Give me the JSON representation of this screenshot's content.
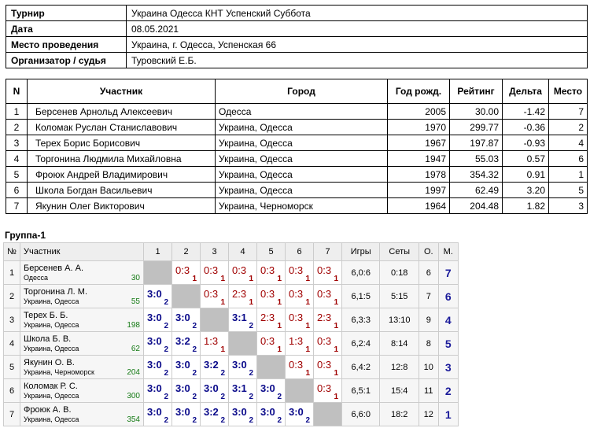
{
  "info": [
    {
      "k": "Турнир",
      "v": "Украина Одесса КНТ Успенский  Суббота"
    },
    {
      "k": "Дата",
      "v": "08.05.2021"
    },
    {
      "k": "Место проведения",
      "v": "Украина, г. Одесса, Успенская 66"
    },
    {
      "k": "Организатор / судья",
      "v": "Туровский Е.Б."
    }
  ],
  "participants": {
    "headers": [
      "N",
      "Участник",
      "Город",
      "Год рожд.",
      "Рейтинг",
      "Дельта",
      "Место"
    ],
    "rows": [
      [
        "1",
        "Берсенев Арнольд Алексеевич",
        "Одесса",
        "2005",
        "30.00",
        "-1.42",
        "7"
      ],
      [
        "2",
        "Коломак Руслан Станиславович",
        "Украина, Одесса",
        "1970",
        "299.77",
        "-0.36",
        "2"
      ],
      [
        "3",
        "Терех Борис Борисович",
        "Украина, Одесса",
        "1967",
        "197.87",
        "-0.93",
        "4"
      ],
      [
        "4",
        "Торгонина Людмила Михайловна",
        "Украина, Одесса",
        "1947",
        "55.03",
        "0.57",
        "6"
      ],
      [
        "5",
        "Фроюк Андрей Владимирович",
        "Украина, Одесса",
        "1978",
        "354.32",
        "0.91",
        "1"
      ],
      [
        "6",
        "Школа Богдан Васильевич",
        "Украина, Одесса",
        "1997",
        "62.49",
        "3.20",
        "5"
      ],
      [
        "7",
        "Якунин Олег Викторович",
        "Украина, Черноморск",
        "1964",
        "204.48",
        "1.82",
        "3"
      ]
    ]
  },
  "group": {
    "title": "Группа-1",
    "headers": [
      "№",
      "Участник",
      "1",
      "2",
      "3",
      "4",
      "5",
      "6",
      "7",
      "Игры",
      "Сеты",
      "О.",
      "М."
    ],
    "rows": [
      {
        "n": "1",
        "name": "Берсенев А. А.",
        "city": "Одесса",
        "rating": "30",
        "cells": [
          null,
          [
            "0:3",
            "1"
          ],
          [
            "0:3",
            "1"
          ],
          [
            "0:3",
            "1"
          ],
          [
            "0:3",
            "1"
          ],
          [
            "0:3",
            "1"
          ],
          [
            "0:3",
            "1"
          ]
        ],
        "games": "6,0:6",
        "sets": "0:18",
        "points": "6",
        "place": "7"
      },
      {
        "n": "2",
        "name": "Торгонина Л. М.",
        "city": "Украина, Одесса",
        "rating": "55",
        "cells": [
          [
            "3:0",
            "2"
          ],
          null,
          [
            "0:3",
            "1"
          ],
          [
            "2:3",
            "1"
          ],
          [
            "0:3",
            "1"
          ],
          [
            "0:3",
            "1"
          ],
          [
            "0:3",
            "1"
          ]
        ],
        "games": "6,1:5",
        "sets": "5:15",
        "points": "7",
        "place": "6"
      },
      {
        "n": "3",
        "name": "Терех Б. Б.",
        "city": "Украина, Одесса",
        "rating": "198",
        "cells": [
          [
            "3:0",
            "2"
          ],
          [
            "3:0",
            "2"
          ],
          null,
          [
            "3:1",
            "2"
          ],
          [
            "2:3",
            "1"
          ],
          [
            "0:3",
            "1"
          ],
          [
            "2:3",
            "1"
          ]
        ],
        "games": "6,3:3",
        "sets": "13:10",
        "points": "9",
        "place": "4"
      },
      {
        "n": "4",
        "name": "Школа Б. В.",
        "city": "Украина, Одесса",
        "rating": "62",
        "cells": [
          [
            "3:0",
            "2"
          ],
          [
            "3:2",
            "2"
          ],
          [
            "1:3",
            "1"
          ],
          null,
          [
            "0:3",
            "1"
          ],
          [
            "1:3",
            "1"
          ],
          [
            "0:3",
            "1"
          ]
        ],
        "games": "6,2:4",
        "sets": "8:14",
        "points": "8",
        "place": "5"
      },
      {
        "n": "5",
        "name": "Якунин О. В.",
        "city": "Украина, Черноморск",
        "rating": "204",
        "cells": [
          [
            "3:0",
            "2"
          ],
          [
            "3:0",
            "2"
          ],
          [
            "3:2",
            "2"
          ],
          [
            "3:0",
            "2"
          ],
          null,
          [
            "0:3",
            "1"
          ],
          [
            "0:3",
            "1"
          ]
        ],
        "games": "6,4:2",
        "sets": "12:8",
        "points": "10",
        "place": "3"
      },
      {
        "n": "6",
        "name": "Коломак Р. С.",
        "city": "Украина, Одесса",
        "rating": "300",
        "cells": [
          [
            "3:0",
            "2"
          ],
          [
            "3:0",
            "2"
          ],
          [
            "3:0",
            "2"
          ],
          [
            "3:1",
            "2"
          ],
          [
            "3:0",
            "2"
          ],
          null,
          [
            "0:3",
            "1"
          ]
        ],
        "games": "6,5:1",
        "sets": "15:4",
        "points": "11",
        "place": "2"
      },
      {
        "n": "7",
        "name": "Фроюк А. В.",
        "city": "Украина, Одесса",
        "rating": "354",
        "cells": [
          [
            "3:0",
            "2"
          ],
          [
            "3:0",
            "2"
          ],
          [
            "3:2",
            "2"
          ],
          [
            "3:0",
            "2"
          ],
          [
            "3:0",
            "2"
          ],
          [
            "3:0",
            "2"
          ],
          null
        ],
        "games": "6,6:0",
        "sets": "18:2",
        "points": "12",
        "place": "1"
      }
    ]
  }
}
